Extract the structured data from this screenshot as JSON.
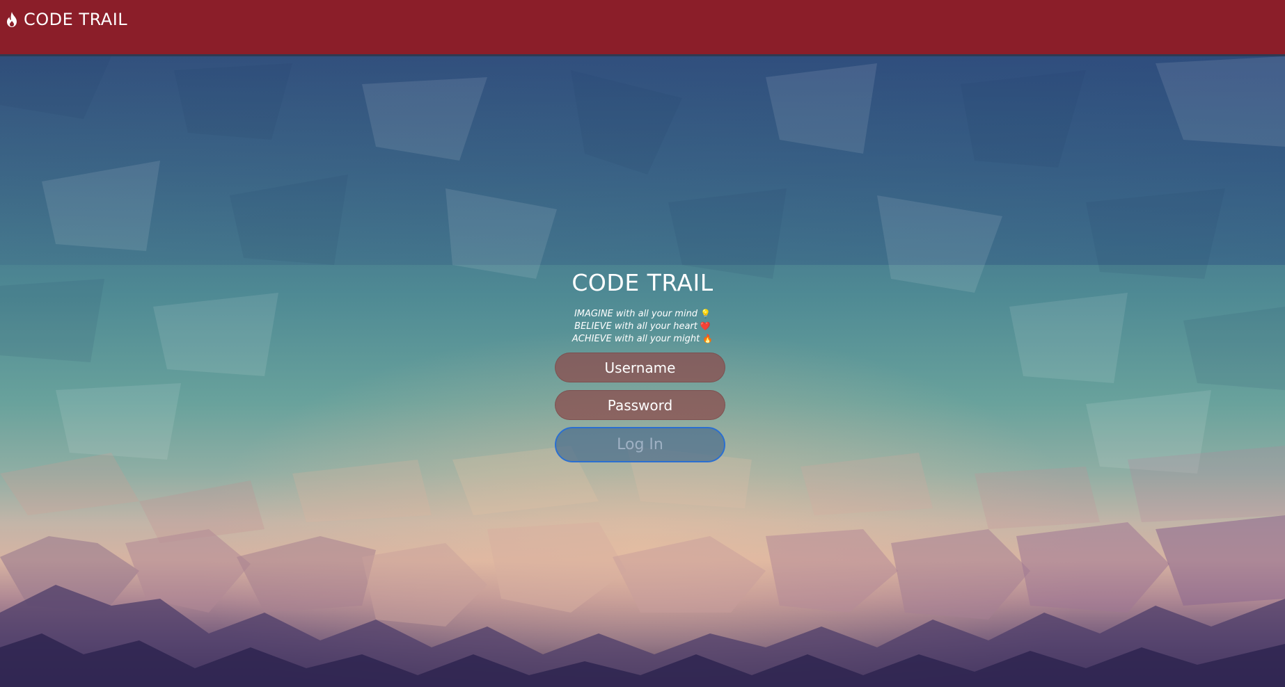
{
  "navbar": {
    "brand_label": "CODE TRAIL",
    "brand_icon": "flame-icon",
    "background_color": "#8b1e29"
  },
  "login": {
    "title": "CODE TRAIL",
    "motto": [
      {
        "text": "IMAGINE with all your mind",
        "emoji": "💡"
      },
      {
        "text": "BELIEVE with all your heart",
        "emoji": "❤️"
      },
      {
        "text": "ACHIEVE with all your might",
        "emoji": "🔥"
      }
    ],
    "username_placeholder": "Username",
    "password_placeholder": "Password",
    "login_button_label": "Log In"
  },
  "colors": {
    "input_background": "#8b5050",
    "button_border": "#2a6fd1",
    "button_text": "#9fb1c4"
  }
}
